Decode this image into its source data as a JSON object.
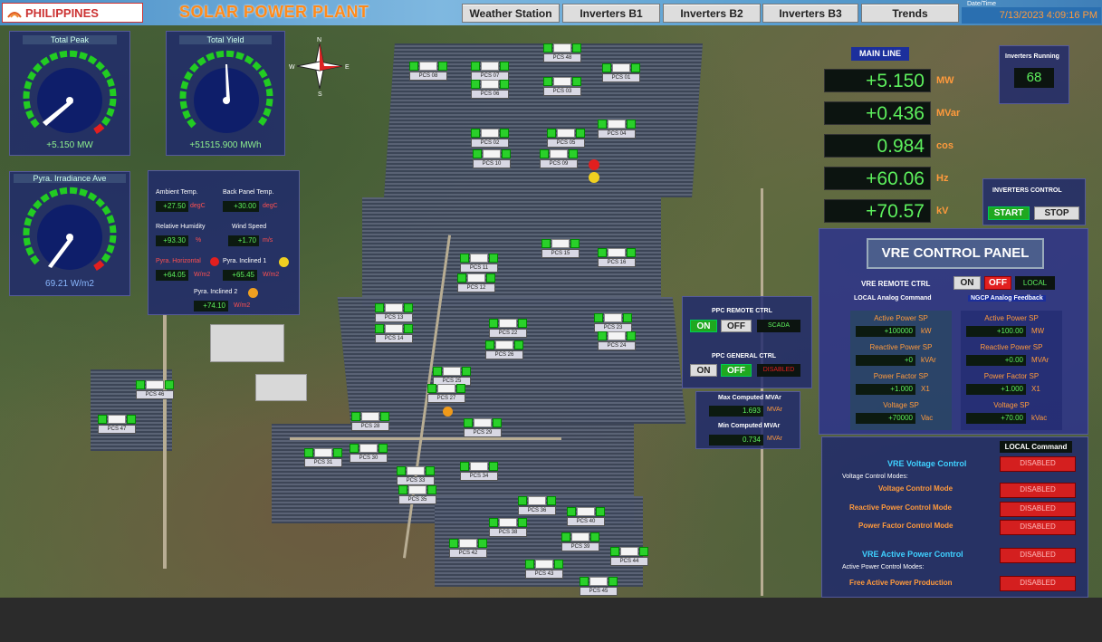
{
  "header": {
    "logo_text": "PHILIPPINES",
    "app_title": "SOLAR POWER PLANT",
    "nav": [
      "Weather Station",
      "Inverters B1",
      "Inverters B2",
      "Inverters B3",
      "Trends"
    ],
    "datetime_label": "Date/Time",
    "datetime": "7/13/2023 4:09:16 PM"
  },
  "gauges": {
    "total_peak": {
      "title": "Total Peak",
      "value": "+5.150",
      "unit": "MW",
      "ticks": [
        "0",
        "20",
        "40",
        "60",
        "80",
        "100",
        "120",
        "140",
        "160"
      ]
    },
    "total_yield": {
      "title": "Total Yield",
      "value": "+51515.900",
      "unit": "MWh",
      "ticks": [
        "0",
        "20000",
        "40000",
        "60000",
        "80000"
      ]
    },
    "irradiance": {
      "title": "Pyra. Irradiance Ave",
      "value": "69.21",
      "unit": "W/m2",
      "ticks": [
        "0",
        "200",
        "400",
        "600",
        "800",
        "1000",
        "1200",
        "1400"
      ]
    }
  },
  "weather": {
    "ambient_label": "Ambient Temp.",
    "ambient_value": "+27.50",
    "ambient_unit": "degC",
    "back_panel_label": "Back Panel Temp.",
    "back_panel_value": "+30.00",
    "back_panel_unit": "degC",
    "humidity_label": "Relative Humidity",
    "humidity_value": "+93.30",
    "humidity_unit": "%",
    "wind_label": "Wind Speed",
    "wind_value": "+1.70",
    "wind_unit": "m/s",
    "horizontal_label": "Pyra. Horizontal",
    "horizontal_value": "+64.05",
    "horizontal_unit": "W/m2",
    "inclined1_label": "Pyra. Inclined 1",
    "inclined1_value": "+65.45",
    "inclined1_unit": "W/m2",
    "inclined2_label": "Pyra. Inclined 2",
    "inclined2_value": "+74.10",
    "inclined2_unit": "W/m2"
  },
  "compass": {
    "n": "N",
    "s": "S",
    "e": "E",
    "w": "W"
  },
  "main_line": {
    "title": "MAIN LINE",
    "rows": [
      {
        "value": "+5.150",
        "unit": "MW"
      },
      {
        "value": "+0.436",
        "unit": "MVar"
      },
      {
        "value": "0.984",
        "unit": "cos"
      },
      {
        "value": "+60.06",
        "unit": "Hz"
      },
      {
        "value": "+70.57",
        "unit": "kV"
      }
    ]
  },
  "inverters_running": {
    "title": "Inverters Running",
    "value": "68"
  },
  "inverters_control": {
    "title": "INVERTERS CONTROL",
    "start": "START",
    "stop": "STOP"
  },
  "ppc": {
    "remote_title": "PPC REMOTE CTRL",
    "on": "ON",
    "off": "OFF",
    "remote_mode": "SCADA",
    "general_title": "PPC GENERAL CTRL",
    "general_on": "ON",
    "general_off": "OFF",
    "general_status": "DISABLED"
  },
  "computed": {
    "max_label": "Max Computed MVAr",
    "max_value": "1.693",
    "max_unit": "MVAr",
    "min_label": "Min Computed MVAr",
    "min_value": "0.734",
    "min_unit": "MVAr"
  },
  "vre": {
    "title": "VRE CONTROL PANEL",
    "remote_label": "VRE REMOTE CTRL",
    "on": "ON",
    "off": "OFF",
    "local": "LOCAL",
    "local_analog": "LOCAL Analog Command",
    "ngcp_analog": "NGCP Analog Feedback",
    "local_rows": [
      {
        "label": "Active Power SP",
        "value": "+100000",
        "unit": "kW"
      },
      {
        "label": "Reactive Power SP",
        "value": "+0",
        "unit": "kVAr"
      },
      {
        "label": "Power Factor SP",
        "value": "+1.000",
        "unit": "X1"
      },
      {
        "label": "Voltage SP",
        "value": "+70000",
        "unit": "Vac"
      }
    ],
    "ngcp_rows": [
      {
        "label": "Active Power SP",
        "value": "+100.00",
        "unit": "MW"
      },
      {
        "label": "Reactive Power SP",
        "value": "+0.00",
        "unit": "MVAr"
      },
      {
        "label": "Power Factor SP",
        "value": "+1.000",
        "unit": "X1"
      },
      {
        "label": "Voltage SP",
        "value": "+70.00",
        "unit": "kVac"
      }
    ]
  },
  "local_command": {
    "header": "LOCAL Command",
    "voltage_control": "VRE Voltage Control",
    "voltage_modes_label": "Voltage Control Modes:",
    "voltage_mode": "Voltage Control Mode",
    "reactive_mode": "Reactive Power Control Mode",
    "pf_mode": "Power Factor Control Mode",
    "active_control": "VRE Active Power Control",
    "active_modes_label": "Active Power Control Modes:",
    "free_active": "Free Active Power Production",
    "disabled": "DISABLED"
  },
  "pcs_units": [
    "PCS 08",
    "PCS 07",
    "PCS 03",
    "PCS 01",
    "PCS 06",
    "PCS 02",
    "PCS 05",
    "PCS 10",
    "PCS 09",
    "PCS 04",
    "PCS 15",
    "PCS 11",
    "PCS 12",
    "PCS 16",
    "PCS 13",
    "PCS 14",
    "PCS 22",
    "PCS 23",
    "PCS 26",
    "PCS 24",
    "PCS 25",
    "PCS 27",
    "PCS 28",
    "PCS 29",
    "PCS 31",
    "PCS 30",
    "PCS 33",
    "PCS 34",
    "PCS 35",
    "PCS 36",
    "PCS 38",
    "PCS 39",
    "PCS 40",
    "PCS 42",
    "PCS 43",
    "PCS 44",
    "PCS 45",
    "PCS 46",
    "PCS 47",
    "PCS 48"
  ]
}
